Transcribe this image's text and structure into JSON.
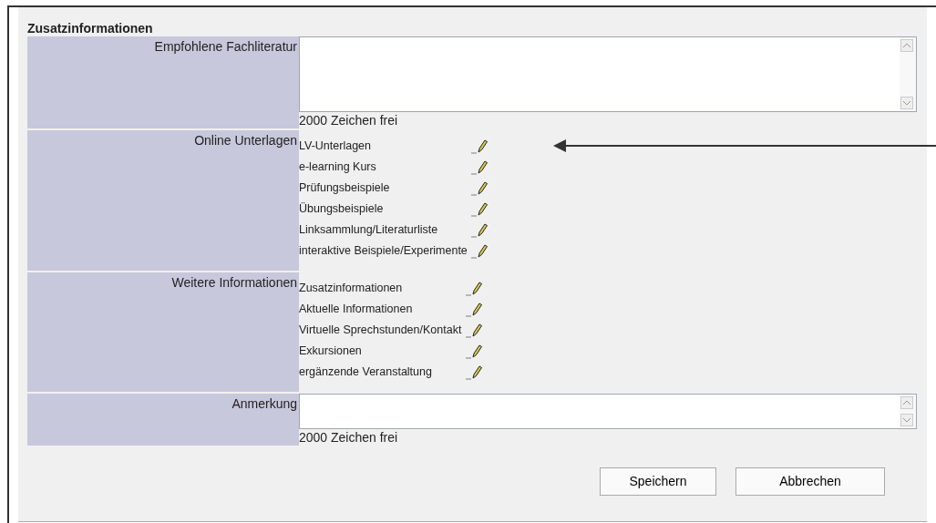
{
  "section_title": "Zusatzinformationen",
  "rows": [
    {
      "kind": "bigtext",
      "label": "Empfohlene Fachliteratur",
      "counter": "2000 Zeichen frei"
    },
    {
      "kind": "links",
      "label": "Online Unterlagen",
      "items": [
        "LV-Unterlagen",
        "e-learning Kurs",
        "Prüfungsbeispiele",
        "Übungsbeispiele",
        "Linksammlung/Literaturliste",
        "interaktive Beispiele/Experimente"
      ]
    },
    {
      "kind": "links",
      "label": "Weitere Informationen",
      "items": [
        "Zusatzinformationen",
        "Aktuelle Informationen",
        "Virtuelle Sprechstunden/Kontakt",
        "Exkursionen",
        "ergänzende Veranstaltung"
      ]
    },
    {
      "kind": "smalltext",
      "label": "Anmerkung",
      "counter": "2000 Zeichen frei"
    }
  ],
  "buttons": [
    "Speichern",
    "Abbrechen"
  ]
}
